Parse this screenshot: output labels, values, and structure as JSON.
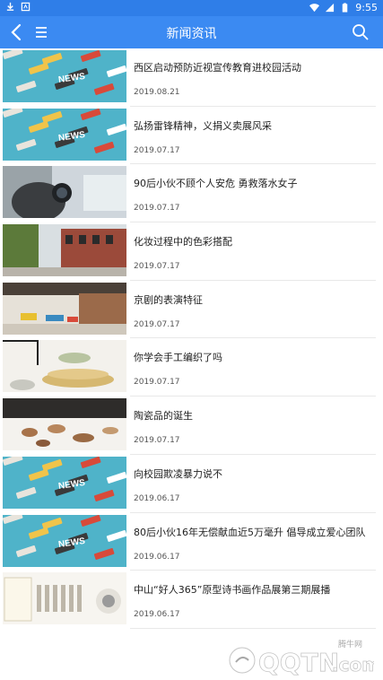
{
  "status_bar": {
    "time": "9:55",
    "icons": [
      "download-icon",
      "app-notification-icon",
      "wifi-icon",
      "signal-icon",
      "battery-icon"
    ]
  },
  "app_bar": {
    "title": "新闻资讯",
    "back_icon": "chevron-left-icon",
    "menu_icon": "menu-icon",
    "search_icon": "search-icon"
  },
  "news": [
    {
      "title": "西区启动预防近视宣传教育进校园活动",
      "date": "2019.08.21",
      "thumb": "news-collage"
    },
    {
      "title": "弘扬雷锋精神，义捐义卖展风采",
      "date": "2019.07.17",
      "thumb": "news-collage"
    },
    {
      "title": "90后小伙不顾个人安危  勇救落水女子",
      "date": "2019.07.17",
      "thumb": "camera-photo"
    },
    {
      "title": "化妆过程中的色彩搭配",
      "date": "2019.07.17",
      "thumb": "street-photo"
    },
    {
      "title": "京剧的表演特征",
      "date": "2019.07.17",
      "thumb": "interior-photo"
    },
    {
      "title": "你学会手工编织了吗",
      "date": "2019.07.17",
      "thumb": "knit-photo"
    },
    {
      "title": "陶瓷品的诞生",
      "date": "2019.07.17",
      "thumb": "ceramics-photo"
    },
    {
      "title": "向校园欺凌暴力说不",
      "date": "2019.06.17",
      "thumb": "news-collage"
    },
    {
      "title": "80后小伙16年无偿献血近5万毫升 倡导成立爱心团队",
      "date": "2019.06.17",
      "thumb": "news-collage"
    },
    {
      "title": "中山“好人365”原型诗书画作品展第三期展播",
      "date": "2019.06.17",
      "thumb": "calligraphy-photo"
    }
  ],
  "watermark": {
    "text": "QQTN",
    "suffix": ".com",
    "small": "腾牛网"
  },
  "colors": {
    "status_bar": "#2f7ee8",
    "app_bar": "#3b8af2",
    "divider": "#e8e8e8"
  }
}
